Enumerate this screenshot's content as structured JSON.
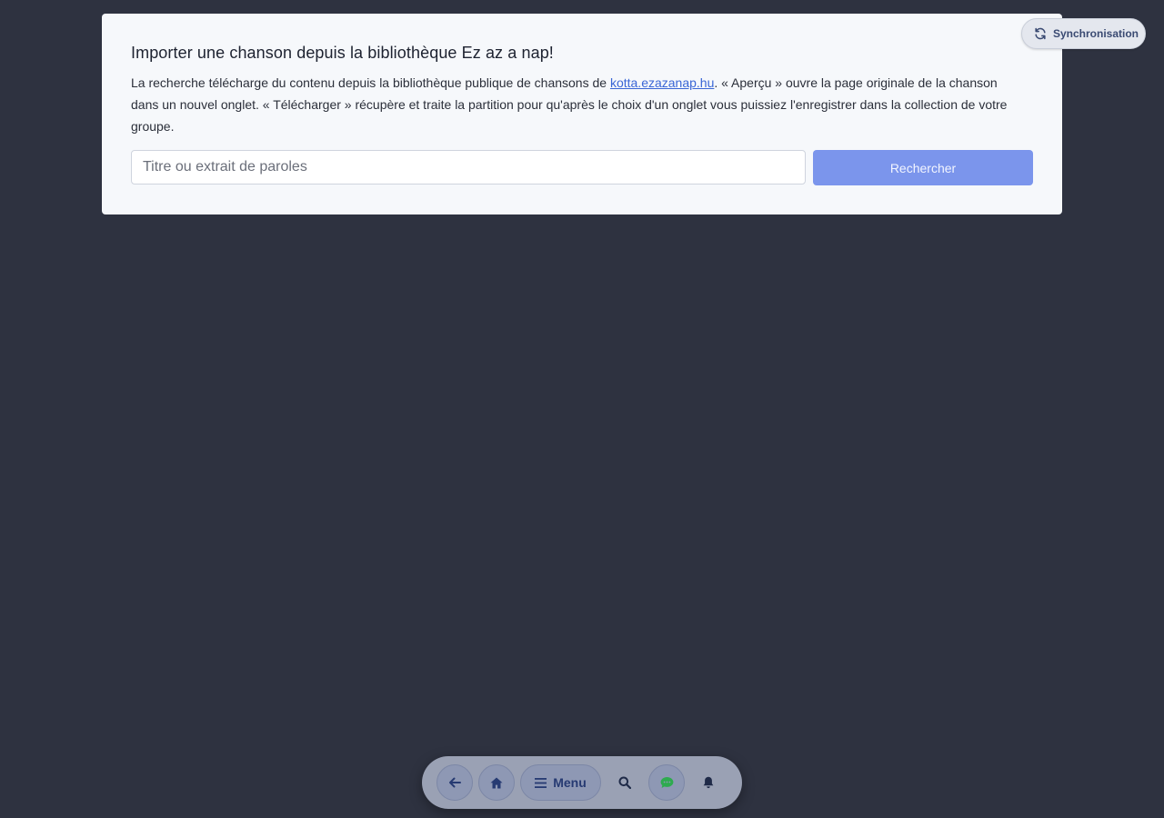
{
  "modal": {
    "title": "Importer une chanson depuis la bibliothèque Ez az a nap!",
    "description_before_link": "La recherche télécharge du contenu depuis la bibliothèque publique de chansons de ",
    "link_text": "kotta.ezazanap.hu",
    "description_after_link": ". « Aperçu » ouvre la page originale de la chanson dans un nouvel onglet. « Télécharger » récupère et traite la partition pour qu'après le choix d'un onglet vous puissiez l'enregistrer dans la collection de votre groupe.",
    "search": {
      "value": "",
      "placeholder": "Titre ou extrait de paroles",
      "button_label": "Rechercher"
    }
  },
  "sync": {
    "label": "Synchronisation",
    "icon": "sync-icon"
  },
  "bottom_nav": {
    "items": [
      {
        "icon": "arrow-left-icon"
      },
      {
        "icon": "home-icon"
      },
      {
        "icon": "hamburger-icon",
        "label": "Menu"
      },
      {
        "icon": "search-icon"
      },
      {
        "icon": "chat-icon"
      },
      {
        "icon": "bell-icon"
      }
    ]
  },
  "colors": {
    "background": "#2e3240",
    "modal": "#f6f8fb",
    "accent_button": "#7b95ec",
    "link": "#3a66d6",
    "chat_icon": "#2eab4f",
    "nav_icon": "#263a72"
  }
}
